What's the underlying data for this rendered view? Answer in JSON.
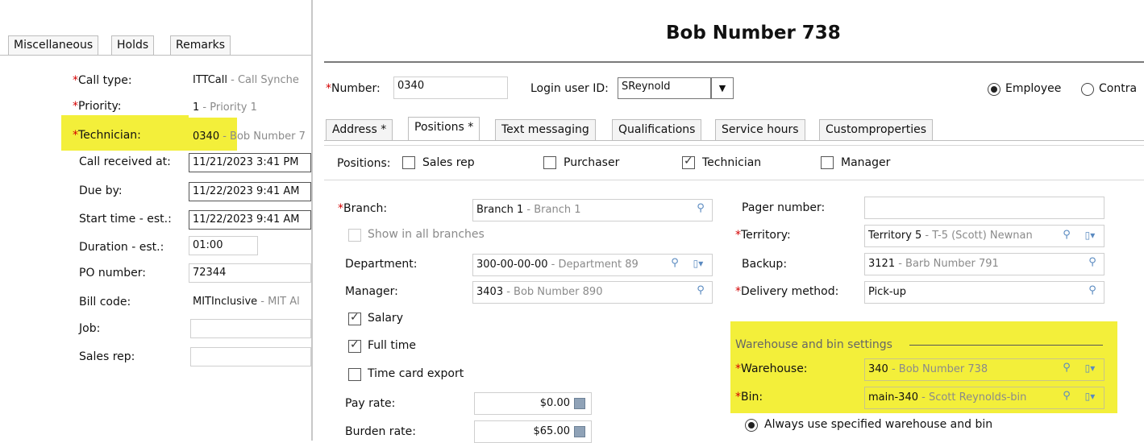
{
  "left_panel": {
    "tabs": [
      "Miscellaneous",
      "Holds",
      "Remarks"
    ],
    "fields": [
      {
        "label": "Call type:",
        "required": true,
        "value_code": "ITTCall",
        "value_desc": " - Call Synche"
      },
      {
        "label": "Priority:",
        "required": true,
        "value_code": "1",
        "value_desc": " - Priority 1"
      },
      {
        "label": "Technician:",
        "required": true,
        "value_code": "0340",
        "value_desc": " - Bob Number 7"
      },
      {
        "label": "Call received at:",
        "required": false,
        "value_code": "11/21/2023  3:41 PM",
        "value_desc": ""
      },
      {
        "label": "Due by:",
        "required": false,
        "value_code": "11/22/2023  9:41 AM",
        "value_desc": ""
      },
      {
        "label": "Start time - est.:",
        "required": false,
        "value_code": "11/22/2023  9:41 AM",
        "value_desc": ""
      },
      {
        "label": "Duration - est.:",
        "required": false,
        "value_code": "01:00",
        "value_desc": ""
      },
      {
        "label": "PO number:",
        "required": false,
        "value_code": "72344",
        "value_desc": ""
      },
      {
        "label": "Bill code:",
        "required": false,
        "value_code": "MITInclusive",
        "value_desc": " - MIT Al"
      },
      {
        "label": "Job:",
        "required": false,
        "value_code": "",
        "value_desc": ""
      },
      {
        "label": "Sales rep:",
        "required": false,
        "value_code": "",
        "value_desc": ""
      }
    ]
  },
  "right_panel": {
    "title": "Bob Number 738",
    "number_label": "Number:",
    "number_value": "0340",
    "login_label": "Login user ID:",
    "login_value": "SReynold",
    "radio_employee": "Employee",
    "radio_contractor": "Contra",
    "tabs": [
      "Address *",
      "Positions *",
      "Text messaging",
      "Qualifications",
      "Service hours",
      "Customproperties"
    ],
    "positions_label": "Positions:",
    "positions": [
      {
        "label": "Sales rep",
        "checked": false
      },
      {
        "label": "Purchaser",
        "checked": false
      },
      {
        "label": "Technician",
        "checked": true
      },
      {
        "label": "Manager",
        "checked": false
      }
    ],
    "branch_label": "Branch:",
    "branch_code": "Branch 1",
    "branch_desc": " - Branch 1",
    "show_all_branches": "Show in all branches",
    "department_label": "Department:",
    "department_code": "300-00-00-00",
    "department_desc": " - Department 89",
    "manager_label": "Manager:",
    "manager_code": "3403",
    "manager_desc": " - Bob Number 890",
    "salary": "Salary",
    "full_time": "Full time",
    "time_card_export": "Time card export",
    "pay_rate_label": "Pay rate:",
    "pay_rate_value": "$0.00",
    "burden_rate_label": "Burden rate:",
    "burden_rate_value": "$65.00",
    "pager_label": "Pager number:",
    "pager_value": "",
    "territory_label": "Territory:",
    "territory_code": "Territory 5",
    "territory_desc": " - T-5 (Scott) Newnan",
    "backup_label": "Backup:",
    "backup_code": "3121",
    "backup_desc": " - Barb Number 791",
    "delivery_label": "Delivery method:",
    "delivery_value": "Pick-up",
    "wh_section": "Warehouse and bin settings",
    "warehouse_label": "Warehouse:",
    "warehouse_code": "340",
    "warehouse_desc": " - Bob Number 738",
    "bin_label": "Bin:",
    "bin_code": "main-340",
    "bin_desc": " - Scott Reynolds-bin",
    "always_use": "Always use specified warehouse and bin"
  },
  "colors": {
    "highlight": "#f3ef3a",
    "required": "#d40000"
  }
}
